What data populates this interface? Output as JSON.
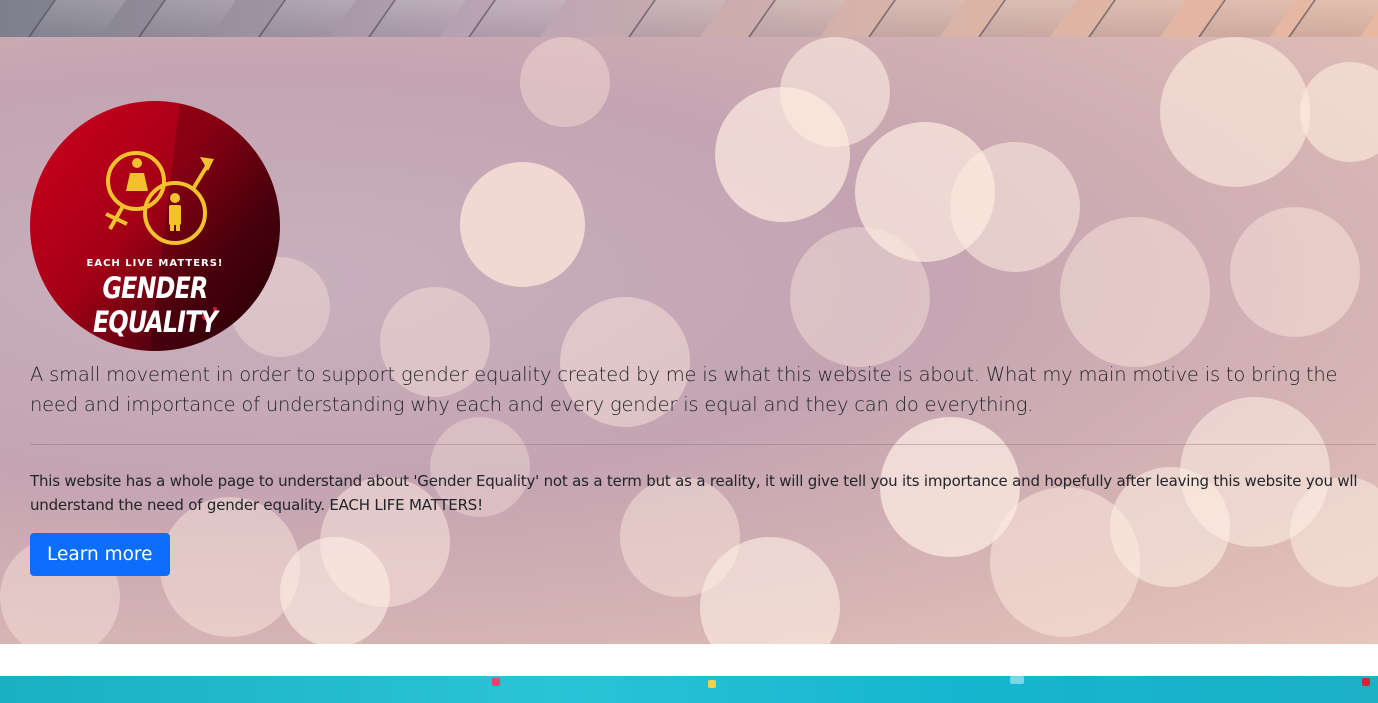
{
  "hero": {
    "logo": {
      "tagline": "EACH LIVE MATTERS!",
      "brand": "GENDER EQUALITY"
    },
    "lead": "A small movement in order to support gender equality created by me is what this website is about. What my main motive is to bring the need and importance of understanding why each and every gender is equal and they can do everything.",
    "body": "This website has a whole page to understand about 'Gender Equality' not as a term but as a reality, it will give tell you its importance and hopefully after leaving this website you wll understand the need of gender equality. EACH LIFE MATTERS!",
    "button_label": "Learn more"
  },
  "colors": {
    "primary_button": "#0d6efd",
    "logo_red": "#c4001a",
    "logo_gold": "#f2c12e",
    "bottom_band": "#1ab0c4"
  }
}
